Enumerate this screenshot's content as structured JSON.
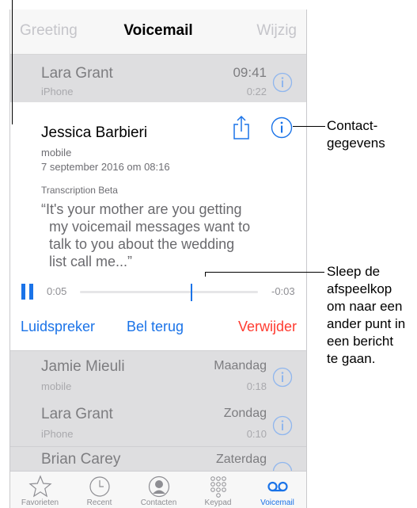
{
  "nav": {
    "left": "Greeting",
    "title": "Voicemail",
    "right": "Wijzig"
  },
  "top_row": {
    "name": "Lara Grant",
    "label": "iPhone",
    "time": "09:41",
    "duration": "0:22"
  },
  "active_message": {
    "name": "Jessica Barbieri",
    "label": "mobile",
    "date": "7 september 2016 om 08:16",
    "transcription_title": "Transcription Beta",
    "transcript_lines": [
      "“It's your mother are you getting",
      "my voicemail messages want to",
      "talk to you about the wedding",
      "list call me...”"
    ],
    "elapsed": "0:05",
    "remaining": "-0:03",
    "progress": 0.62,
    "actions": {
      "speaker": "Luidspreker",
      "call_back": "Bel terug",
      "delete": "Verwijder"
    }
  },
  "rows": [
    {
      "name": "Jamie Mieuli",
      "label": "mobile",
      "day": "Maandag",
      "duration": "0:18"
    },
    {
      "name": "Lara Grant",
      "label": "iPhone",
      "day": "Zondag",
      "duration": "0:10"
    },
    {
      "name": "Brian Carey",
      "label": "",
      "day": "Zaterdag",
      "duration": ""
    }
  ],
  "tabs": [
    {
      "label": "Favorieten",
      "icon": "star-icon"
    },
    {
      "label": "Recent",
      "icon": "clock-icon"
    },
    {
      "label": "Contacten",
      "icon": "contact-icon"
    },
    {
      "label": "Keypad",
      "icon": "keypad-icon"
    },
    {
      "label": "Voicemail",
      "icon": "voicemail-icon"
    }
  ],
  "callouts": {
    "contact": [
      "Contact-",
      "gegevens"
    ],
    "scrub": [
      "Sleep de",
      "afspeelkop",
      "om naar een",
      "ander punt in",
      "een bericht",
      "te gaan."
    ]
  },
  "colors": {
    "accent": "#1a73e8",
    "destructive": "#ff3b30",
    "dimmed_row": "#dedee0"
  }
}
